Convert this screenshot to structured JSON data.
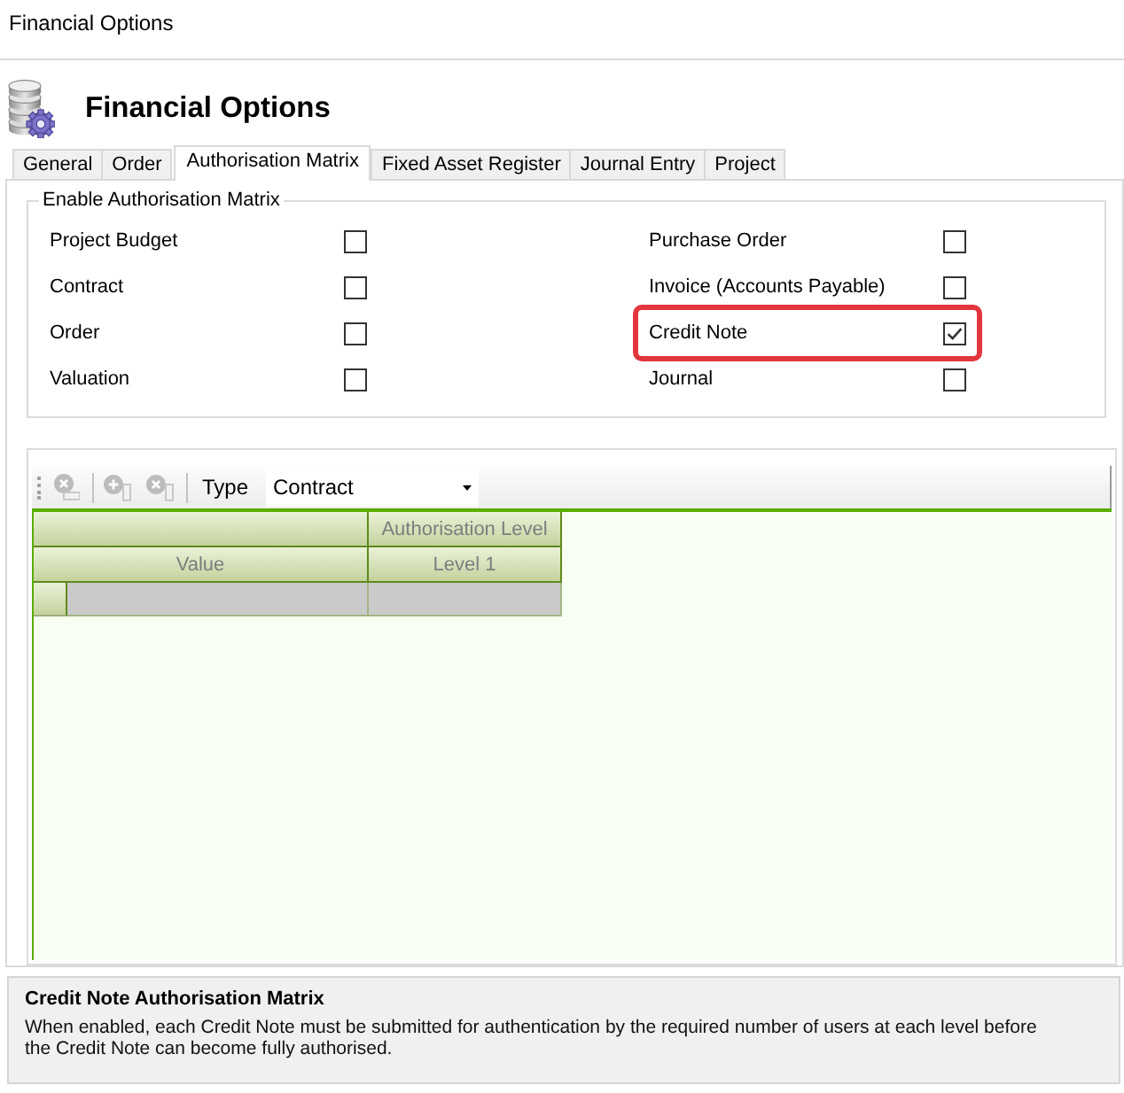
{
  "window": {
    "title": "Financial Options"
  },
  "header": {
    "title": "Financial Options"
  },
  "tabs": [
    {
      "label": "General",
      "selected": false
    },
    {
      "label": "Order",
      "selected": false
    },
    {
      "label": "Authorisation Matrix",
      "selected": true
    },
    {
      "label": "Fixed Asset Register",
      "selected": false
    },
    {
      "label": "Journal Entry",
      "selected": false
    },
    {
      "label": "Project",
      "selected": false
    }
  ],
  "authorisation_group": {
    "title": "Enable Authorisation Matrix",
    "left_options": [
      {
        "label": "Project Budget",
        "checked": false,
        "highlighted": false
      },
      {
        "label": "Contract",
        "checked": false,
        "highlighted": false
      },
      {
        "label": "Order",
        "checked": false,
        "highlighted": false
      },
      {
        "label": "Valuation",
        "checked": false,
        "highlighted": false
      }
    ],
    "right_options": [
      {
        "label": "Purchase Order",
        "checked": false,
        "highlighted": false
      },
      {
        "label": "Invoice (Accounts Payable)",
        "checked": false,
        "highlighted": false
      },
      {
        "label": "Credit Note",
        "checked": true,
        "highlighted": true
      },
      {
        "label": "Journal",
        "checked": false,
        "highlighted": false
      }
    ]
  },
  "toolbar": {
    "button_groups": [
      [
        {
          "kind": "remove-row",
          "disabled": true
        }
      ],
      [
        {
          "kind": "add-column",
          "disabled": true
        },
        {
          "kind": "remove-column",
          "disabled": true
        }
      ]
    ],
    "type_label": "Type",
    "type_value": "Contract"
  },
  "grid": {
    "column_group": "Authorisation Level",
    "columns": [
      {
        "label": "Value"
      },
      {
        "label": "Level 1"
      }
    ],
    "rows": [
      {
        "selected": false
      }
    ]
  },
  "description": {
    "title": "Credit Note Authorisation Matrix",
    "text": "When enabled, each Credit Note must be submitted for authentication by the required number of users at each level before the Credit Note can become fully authorised."
  }
}
